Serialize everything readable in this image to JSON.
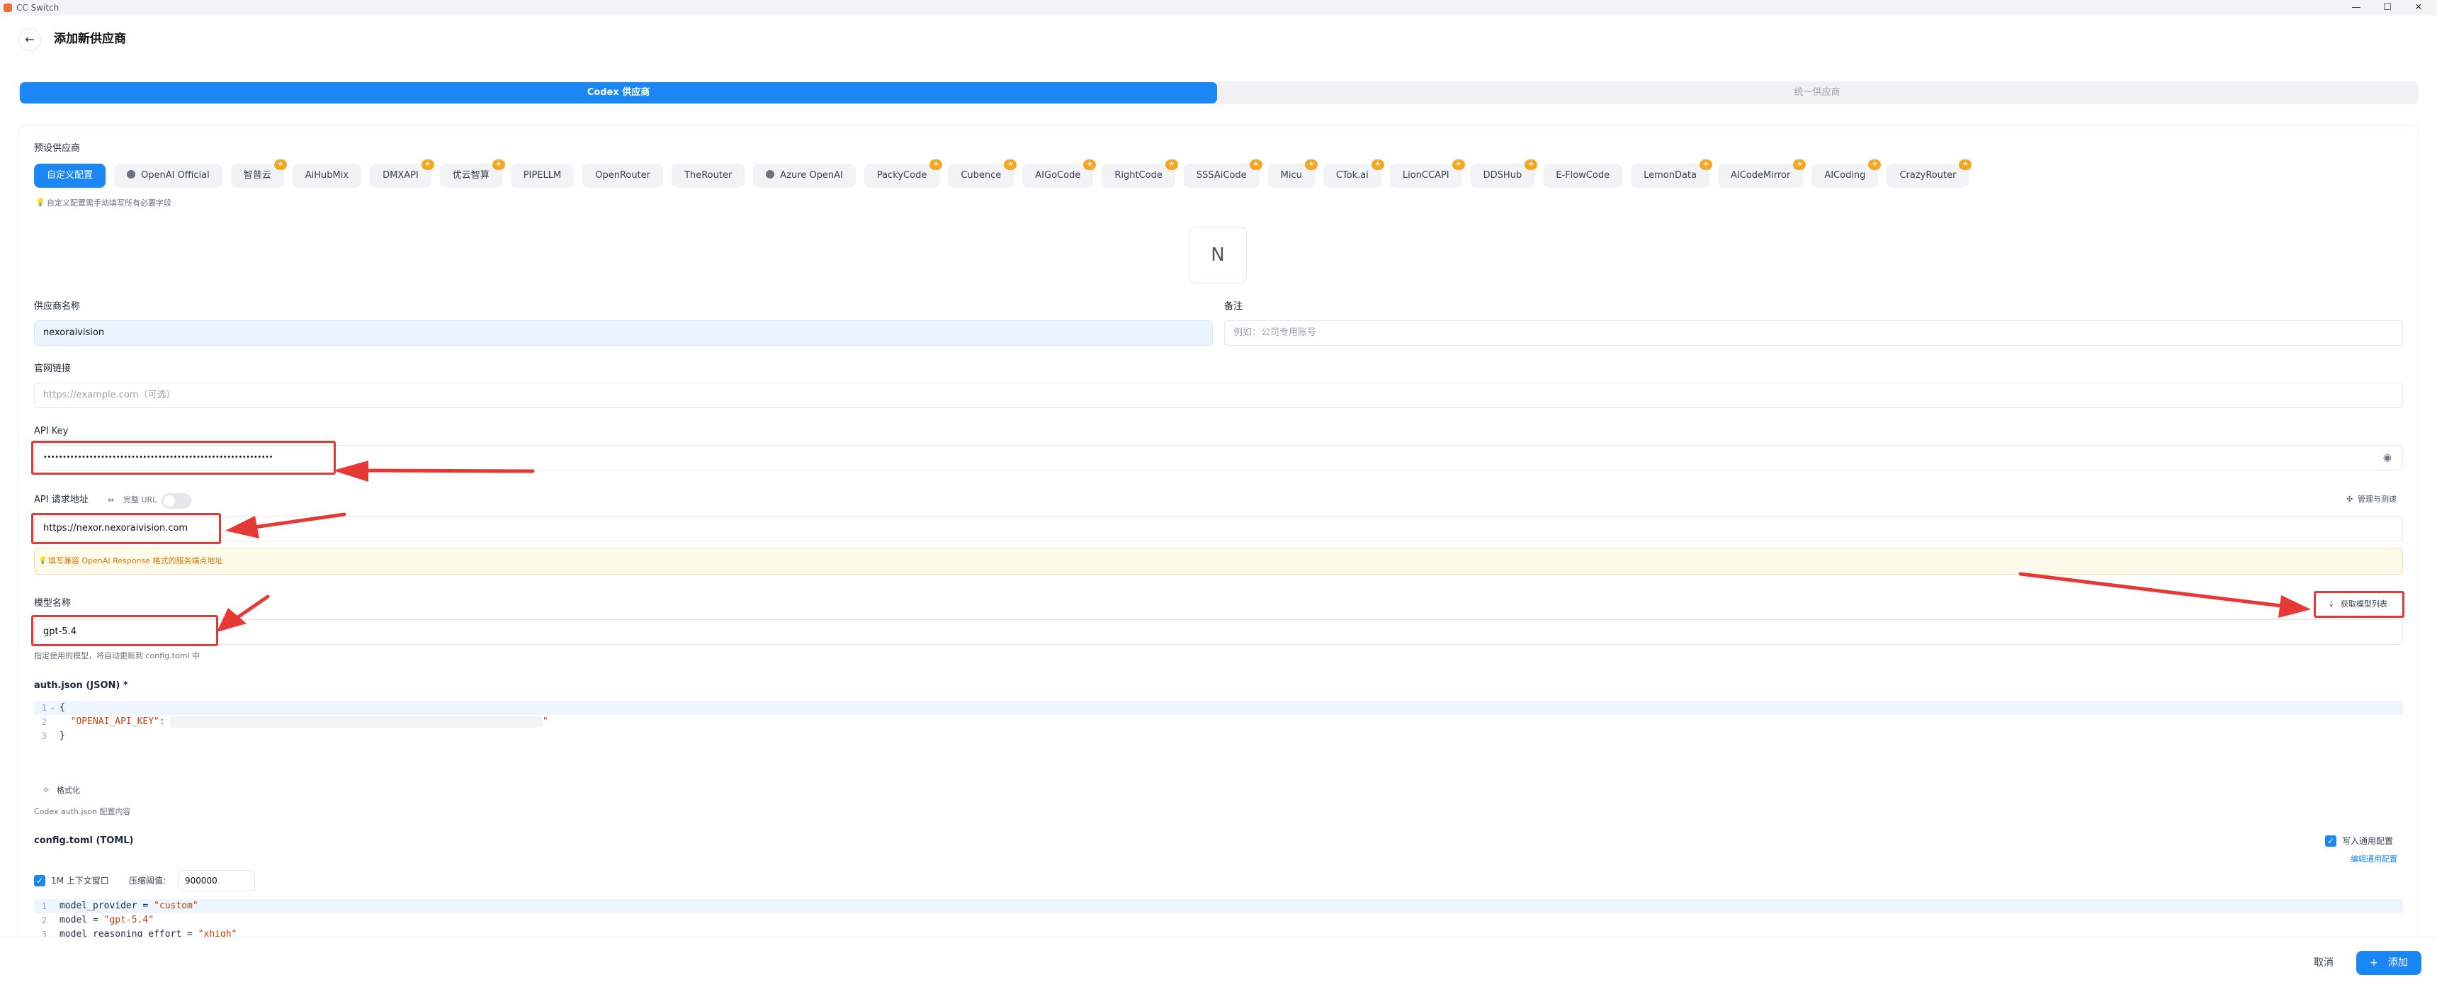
{
  "window": {
    "title": "CC Switch",
    "minimize": "—",
    "maximize": "☐",
    "close": "✕"
  },
  "header": {
    "back_icon": "←",
    "title": "添加新供应商"
  },
  "tabs": [
    {
      "label": "Codex 供应商",
      "active": true
    },
    {
      "label": "统一供应商",
      "active": false
    }
  ],
  "presets": {
    "label": "预设供应商",
    "hint": "自定义配置需手动填写所有必要字段",
    "items": [
      {
        "label": "自定义配置",
        "active": true,
        "badge": false,
        "icon": false
      },
      {
        "label": "OpenAI Official",
        "badge": false,
        "icon": true
      },
      {
        "label": "智普云",
        "badge": true,
        "icon": false
      },
      {
        "label": "AiHubMix",
        "badge": false,
        "icon": false
      },
      {
        "label": "DMXAPI",
        "badge": true,
        "icon": false
      },
      {
        "label": "优云智算",
        "badge": true,
        "icon": false
      },
      {
        "label": "PIPELLM",
        "badge": false,
        "icon": false
      },
      {
        "label": "OpenRouter",
        "badge": false,
        "icon": false
      },
      {
        "label": "TheRouter",
        "badge": false,
        "icon": false
      },
      {
        "label": "Azure OpenAI",
        "badge": false,
        "icon": true
      },
      {
        "label": "PackyCode",
        "badge": true,
        "icon": false
      },
      {
        "label": "Cubence",
        "badge": true,
        "icon": false
      },
      {
        "label": "AIGoCode",
        "badge": true,
        "icon": false
      },
      {
        "label": "RightCode",
        "badge": true,
        "icon": false
      },
      {
        "label": "SSSAiCode",
        "badge": true,
        "icon": false
      },
      {
        "label": "Micu",
        "badge": true,
        "icon": false
      },
      {
        "label": "CTok.ai",
        "badge": true,
        "icon": false
      },
      {
        "label": "LionCCAPI",
        "badge": true,
        "icon": false
      },
      {
        "label": "DDSHub",
        "badge": true,
        "icon": false
      },
      {
        "label": "E-FlowCode",
        "badge": false,
        "icon": false
      },
      {
        "label": "LemonData",
        "badge": true,
        "icon": false
      },
      {
        "label": "AICodeMirror",
        "badge": true,
        "icon": false
      },
      {
        "label": "AICoding",
        "badge": true,
        "icon": false
      },
      {
        "label": "CrazyRouter",
        "badge": true,
        "icon": false
      }
    ]
  },
  "logo_letter": "N",
  "form": {
    "provider_name_label": "供应商名称",
    "provider_name_value": "nexoraivision",
    "notes_label": "备注",
    "notes_placeholder": "例如：公司专用账号",
    "website_label": "官网链接",
    "website_placeholder": "https://example.com（可选）",
    "api_key_label": "API Key",
    "api_key_value": "••••••••••••••••••••••••••••••••••••••••••••••••••••••••••••",
    "api_url_label": "API 请求地址",
    "full_url_label": "完整 URL",
    "manage_test_label": "管理与测速",
    "api_url_value": "https://nexor.nexoraivision.com",
    "api_url_warning": "填写兼容 OpenAI Response 格式的服务端点地址",
    "model_label": "模型名称",
    "fetch_models_label": "获取模型列表",
    "model_value": "gpt-5.4",
    "model_hint": "指定使用的模型，将自动更新到 config.toml 中"
  },
  "auth_json": {
    "label": "auth.json (JSON) *",
    "lines": [
      "{",
      "  \"OPENAI_API_KEY\": \"",
      "}"
    ],
    "line_numbers": [
      "1",
      "2",
      "3"
    ],
    "format_label": "格式化",
    "hint": "Codex auth.json 配置内容"
  },
  "config_toml": {
    "label": "config.toml (TOML)",
    "write_common_label": "写入通用配置",
    "edit_common_label": "编辑通用配置",
    "context_label": "1M 上下文窗口",
    "compress_label": "压缩阈值:",
    "compress_value": "900000",
    "line_numbers": [
      "1",
      "2",
      "3"
    ],
    "lines": [
      {
        "key": "model_provider = ",
        "val": "\"custom\""
      },
      {
        "key": "model = ",
        "val": "\"gpt-5.4\""
      },
      {
        "key": "model_reasoning_effort = ",
        "val": "\"xhigh\""
      }
    ]
  },
  "footer": {
    "cancel_label": "取消",
    "add_label": "添加",
    "add_icon": "+"
  },
  "colors": {
    "accent": "#1a87f5",
    "annotation": "#e53935",
    "badge": "#f5a623",
    "warning": "#d97706"
  }
}
